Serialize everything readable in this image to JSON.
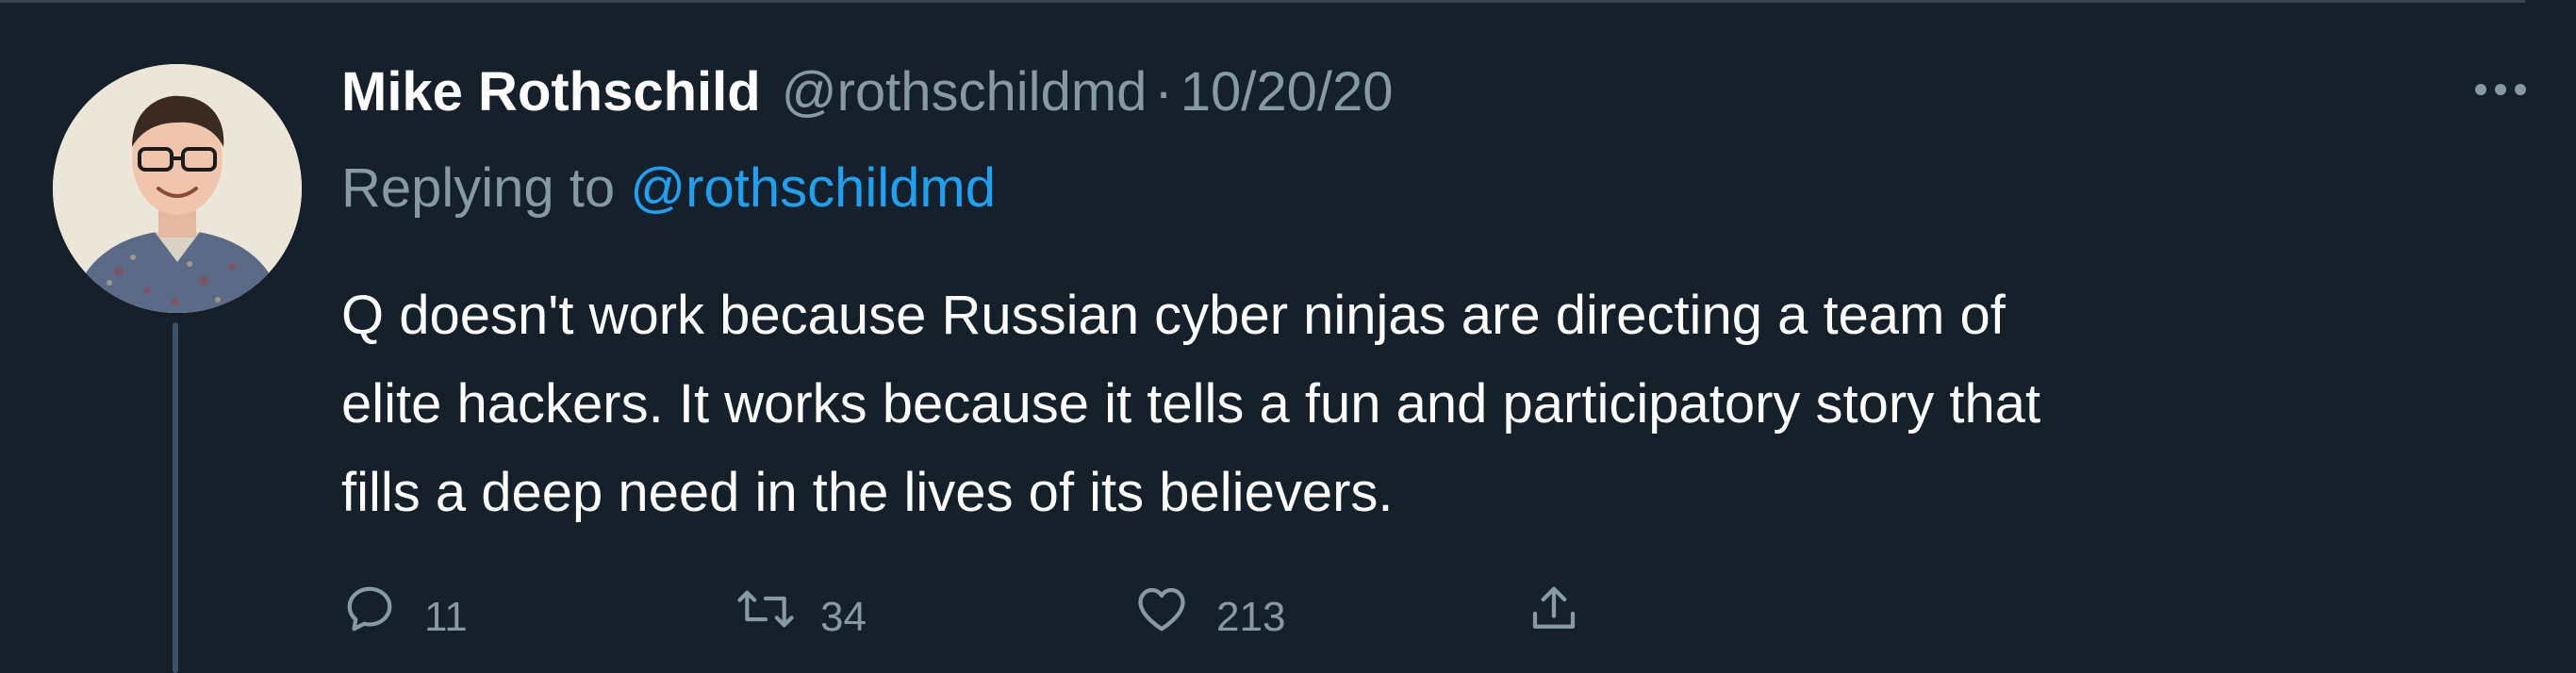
{
  "tweet": {
    "display_name": "Mike Rothschild",
    "handle": "@rothschildmd",
    "separator": "·",
    "timestamp": "10/20/20",
    "replying_prefix": "Replying to ",
    "replying_handle": "@rothschildmd",
    "text": "Q doesn't work because Russian cyber ninjas are directing a team of\nelite hackers. It works because it tells a fun and participatory story that\nfills a deep need in the lives of its believers."
  },
  "actions": {
    "reply": {
      "icon": "reply-icon",
      "count": "11"
    },
    "retweet": {
      "icon": "retweet-icon",
      "count": "34"
    },
    "like": {
      "icon": "heart-icon",
      "count": "213"
    },
    "share": {
      "icon": "share-icon"
    }
  },
  "more": {
    "icon": "more-icon"
  },
  "colors": {
    "background": "#15202b",
    "primary_text": "#ffffff",
    "secondary_text": "#8899a6",
    "link": "#1da1f2",
    "thread_line": "#3d5466"
  }
}
